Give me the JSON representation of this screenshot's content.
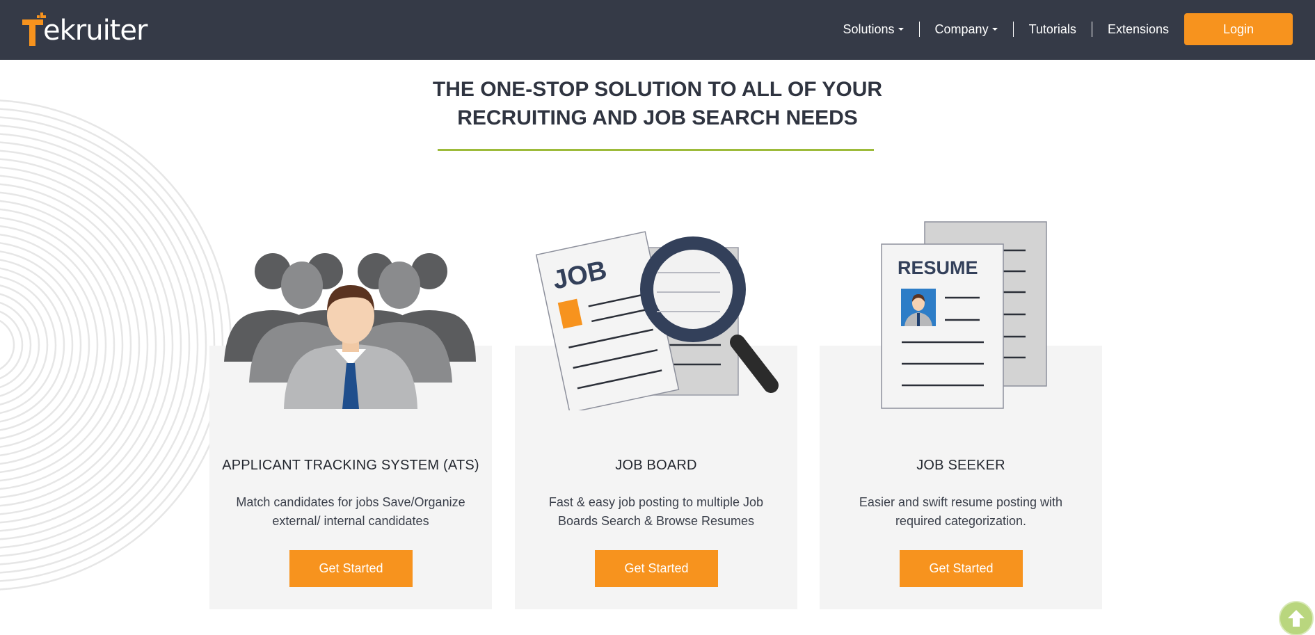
{
  "brand": {
    "name": "Tekruiter",
    "logo_rest": "ekruiter",
    "accent": "#f7931e",
    "header_bg": "#353a47"
  },
  "nav": {
    "items": [
      {
        "label": "Solutions",
        "dropdown": true
      },
      {
        "label": "Company",
        "dropdown": true
      },
      {
        "label": "Tutorials",
        "dropdown": false
      },
      {
        "label": "Extensions",
        "dropdown": false
      }
    ],
    "login_label": "Login"
  },
  "hero": {
    "line1": "THE ONE-STOP SOLUTION TO ALL OF YOUR",
    "line2": "RECRUITING AND JOB SEARCH NEEDS",
    "underline_color": "#9dbb3a"
  },
  "cards": [
    {
      "icon": "people-group-icon",
      "title": "APPLICANT TRACKING SYSTEM (ATS)",
      "desc_line1": "Match candidates for jobs Save/Organize",
      "desc_line2": "external/ internal candidates",
      "button": "Get Started"
    },
    {
      "icon": "job-search-icon",
      "title": "JOB BOARD",
      "doc_label": "JOB",
      "desc_line1": "Fast & easy job posting to multiple Job",
      "desc_line2": "Boards Search & Browse Resumes",
      "button": "Get Started"
    },
    {
      "icon": "resume-document-icon",
      "title": "JOB SEEKER",
      "doc_label": "RESUME",
      "desc_line1": "Easier and swift resume posting with",
      "desc_line2": "required categorization.",
      "button": "Get Started"
    }
  ],
  "scroll_top": {
    "icon": "arrow-up-icon"
  }
}
